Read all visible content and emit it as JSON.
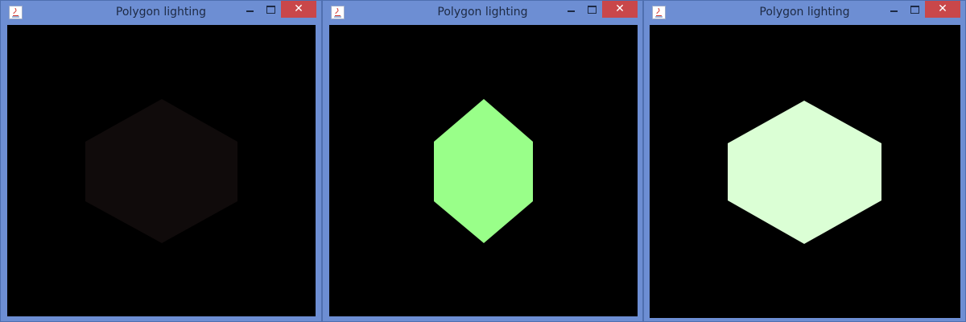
{
  "windows": [
    {
      "title": "Polygon lighting",
      "icon": "java-icon",
      "controls": {
        "minimize": "minimize",
        "maximize": "maximize",
        "close": "✕"
      },
      "polygon_color": "#100b0b"
    },
    {
      "title": "Polygon lighting",
      "icon": "java-icon",
      "controls": {
        "minimize": "minimize",
        "maximize": "maximize",
        "close": "✕"
      },
      "polygon_color": "#99ff89"
    },
    {
      "title": "Polygon lighting",
      "icon": "java-icon",
      "controls": {
        "minimize": "minimize",
        "maximize": "maximize",
        "close": "✕"
      },
      "polygon_color": "#dbffd5"
    }
  ],
  "colors": {
    "titlebar": "#6d8ed3",
    "close_button": "#c9474a",
    "canvas_background": "#000000"
  }
}
